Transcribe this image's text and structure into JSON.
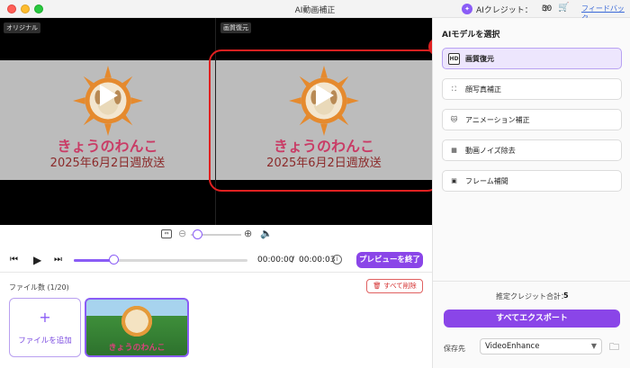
{
  "window": {
    "title": "AI動画補正"
  },
  "header": {
    "credit_label": "AIクレジット：",
    "credit_value": "30",
    "feedback": "フィードバック"
  },
  "preview": {
    "left_tag": "オリジナル",
    "right_tag": "画質復元",
    "logo_text": "きょうのわんこ",
    "date_text": "2025年6月2日週放送",
    "step_badge": "7"
  },
  "playback": {
    "time_current": "00:00:00",
    "time_separator": "/",
    "time_total": "00:00:03",
    "progress_fraction": 0.23,
    "end_preview": "プレビューを終了"
  },
  "files": {
    "count_label": "ファイル数 (1/20)",
    "delete_all": "すべて削除",
    "add_plus": "+",
    "add_label": "ファイルを追加",
    "thumb_text": "きょうのわんこ"
  },
  "panel": {
    "title": "AIモデルを選択",
    "models": [
      {
        "label": "画質復元",
        "icon": "HD",
        "selected": true
      },
      {
        "label": "顔写真補正",
        "icon": "face-scan",
        "selected": false
      },
      {
        "label": "アニメーション補正",
        "icon": "cat-face",
        "selected": false
      },
      {
        "label": "動画ノイズ除去",
        "icon": "noise",
        "selected": false
      },
      {
        "label": "フレーム補間",
        "icon": "frame",
        "selected": false
      }
    ],
    "est_label": "推定クレジット合計：",
    "est_value": "5",
    "export_all": "すべてエクスポート",
    "save_label": "保存先",
    "save_value": "VideoEnhance"
  },
  "colors": {
    "accent": "#8a45e8",
    "highlight": "#e02020"
  }
}
